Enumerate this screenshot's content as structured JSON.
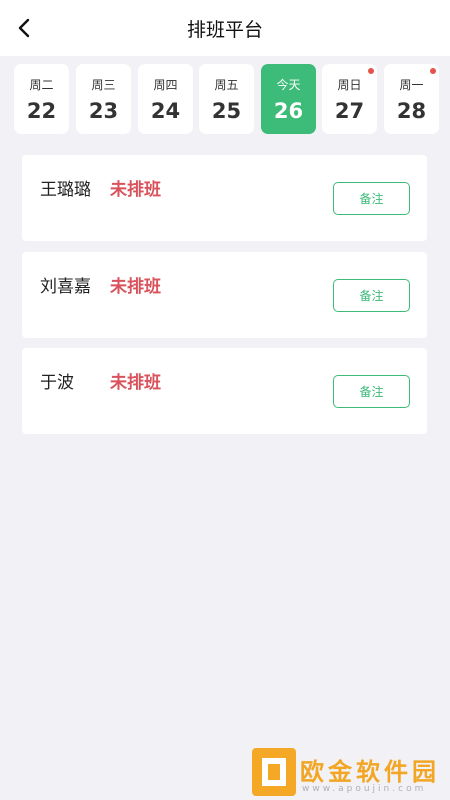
{
  "header": {
    "title": "排班平台",
    "back_icon": "chevron-left-icon"
  },
  "days": [
    {
      "weekday": "周二",
      "date": "22",
      "active": false,
      "has_dot": false
    },
    {
      "weekday": "周三",
      "date": "23",
      "active": false,
      "has_dot": false
    },
    {
      "weekday": "周四",
      "date": "24",
      "active": false,
      "has_dot": false
    },
    {
      "weekday": "周五",
      "date": "25",
      "active": false,
      "has_dot": false
    },
    {
      "weekday": "今天",
      "date": "26",
      "active": true,
      "has_dot": false
    },
    {
      "weekday": "周日",
      "date": "27",
      "active": false,
      "has_dot": true
    },
    {
      "weekday": "周一",
      "date": "28",
      "active": false,
      "has_dot": true
    }
  ],
  "staff": [
    {
      "name": "王璐璐",
      "status": "未排班",
      "note_label": "备注"
    },
    {
      "name": "刘喜嘉",
      "status": "未排班",
      "note_label": "备注"
    },
    {
      "name": "于波",
      "status": "未排班",
      "note_label": "备注"
    }
  ],
  "watermark": {
    "brand": "欧金软件园",
    "url": "www.apoujin.com"
  },
  "colors": {
    "accent": "#3dbb78",
    "status_red": "#d9535c",
    "dot_red": "#e5534b",
    "background": "#f2f2f6",
    "watermark_orange": "#f4a825"
  }
}
